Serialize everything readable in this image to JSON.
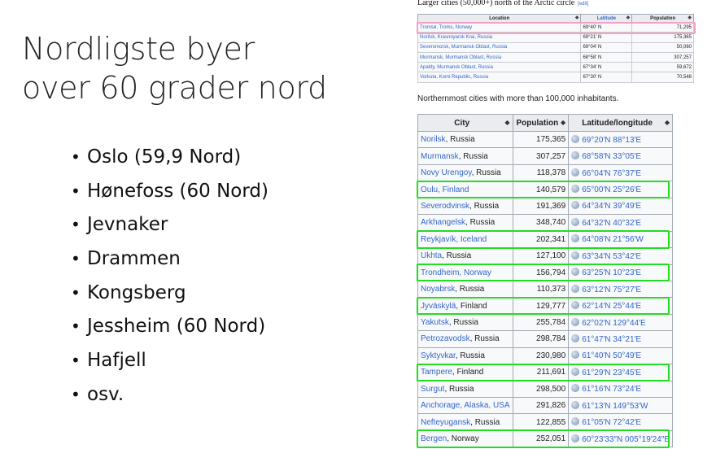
{
  "slide": {
    "title_line1": "Nordligste byer",
    "title_line2": "over 60 grader nord",
    "bullets": [
      "Oslo (59,9 Nord)",
      "Hønefoss (60 Nord)",
      "Jevnaker",
      "Drammen",
      "Kongsberg",
      "Jessheim (60 Nord)",
      "Hafjell",
      "osv."
    ]
  },
  "arctic_table": {
    "heading": "Larger cities (50,000+) north of the Arctic circle",
    "edit_label": "[edit]",
    "headers": [
      "Location",
      "Latitude",
      "Population"
    ],
    "rows": [
      [
        "Tromsø, Troms, Norway",
        "69°40' N",
        "71,295"
      ],
      [
        "Norilsk, Krasnoyarsk Krai, Russia",
        "69°21' N",
        "175,365"
      ],
      [
        "Severomorsk, Murmansk Oblast, Russia",
        "69°04' N",
        "50,060"
      ],
      [
        "Murmansk, Murmansk Oblast, Russia",
        "68°58' N",
        "307,257"
      ],
      [
        "Apatity, Murmansk Oblast, Russia",
        "67°34' N",
        "59,672"
      ],
      [
        "Vorkuta, Komi Republic, Russia",
        "67°30' N",
        "70,548"
      ]
    ],
    "highlight_color": "#f5a0c8"
  },
  "caption": "Northernmost cities with more than 100,000 inhabitants.",
  "cities_table": {
    "headers": [
      "City",
      "Population",
      "Latitude/longitude"
    ],
    "rows": [
      {
        "link": "Norilsk",
        "country": ", Russia",
        "pop": "175,365",
        "coord": "69°20′N 88°13′E",
        "hl": false
      },
      {
        "link": "Murmansk",
        "country": ", Russia",
        "pop": "307,257",
        "coord": "68°58′N 33°05′E",
        "hl": false
      },
      {
        "link": "Novy Urengoy",
        "country": ", Russia",
        "pop": "118,378",
        "coord": "66°04′N 76°37′E",
        "hl": false
      },
      {
        "link": "Oulu, Finland",
        "country": "",
        "pop": "140,579",
        "coord": "65°00′N 25°26′E",
        "hl": true
      },
      {
        "link": "Severodvinsk",
        "country": ", Russia",
        "pop": "191,369",
        "coord": "64°34′N 39°49′E",
        "hl": false
      },
      {
        "link": "Arkhangelsk",
        "country": ", Russia",
        "pop": "348,740",
        "coord": "64°32′N 40°32′E",
        "hl": false
      },
      {
        "link": "Reykjavík, Iceland",
        "country": "",
        "pop": "202,341",
        "coord": "64°08′N 21°56′W",
        "hl": true
      },
      {
        "link": "Ukhta",
        "country": ", Russia",
        "pop": "127,100",
        "coord": "63°34′N 53°42′E",
        "hl": false
      },
      {
        "link": "Trondheim, Norway",
        "country": "",
        "pop": "156,794",
        "coord": "63°25′N 10°23′E",
        "hl": true
      },
      {
        "link": "Noyabrsk",
        "country": ", Russia",
        "pop": "110,373",
        "coord": "63°12′N 75°27′E",
        "hl": false
      },
      {
        "link": "Jyväskylä",
        "country": ", Finland",
        "pop": "129,777",
        "coord": "62°14′N 25°44′E",
        "hl": true
      },
      {
        "link": "Yakutsk",
        "country": ", Russia",
        "pop": "255,784",
        "coord": "62°02′N 129°44′E",
        "hl": false
      },
      {
        "link": "Petrozavodsk",
        "country": ", Russia",
        "pop": "298,784",
        "coord": "61°47′N 34°21′E",
        "hl": false
      },
      {
        "link": "Syktyvkar",
        "country": ", Russia",
        "pop": "230,980",
        "coord": "61°40′N 50°49′E",
        "hl": false
      },
      {
        "link": "Tampere",
        "country": ", Finland",
        "pop": "211,691",
        "coord": "61°29′N 23°45′E",
        "hl": true
      },
      {
        "link": "Surgut",
        "country": ", Russia",
        "pop": "298,500",
        "coord": "61°16′N 73°24′E",
        "hl": false
      },
      {
        "link": "Anchorage, Alaska, USA",
        "country": "",
        "pop": "291,826",
        "coord": "61°13′N 149°53′W",
        "hl": false
      },
      {
        "link": "Nefteyugansk",
        "country": ", Russia",
        "pop": "122,855",
        "coord": "61°05′N 72°42′E",
        "hl": false
      },
      {
        "link": "Bergen",
        "country": ", Norway",
        "pop": "252,051",
        "coord": "60°23′33″N 005°19′24″E",
        "hl": true
      }
    ],
    "highlight_color": "#22dd22"
  }
}
